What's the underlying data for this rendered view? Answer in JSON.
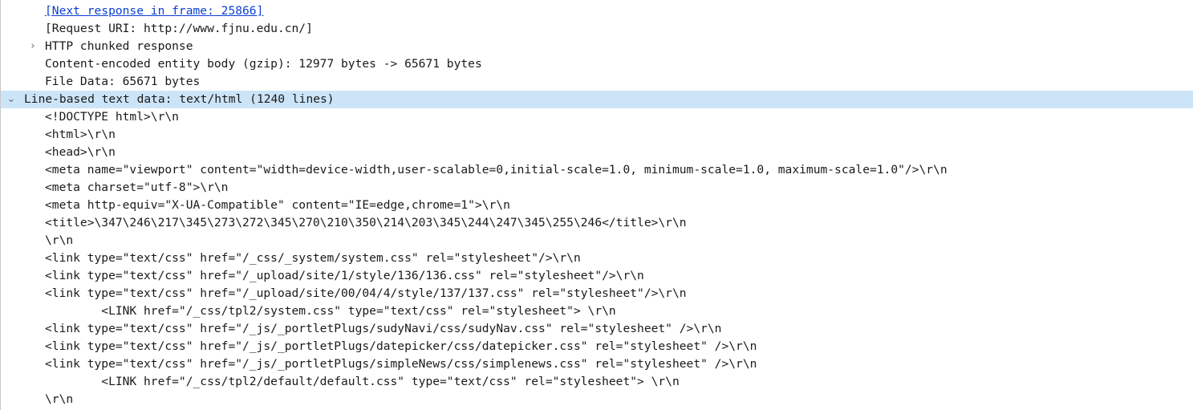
{
  "tree": {
    "next_response": "[Next response in frame: 25866]",
    "request_uri": "[Request URI: http://www.fjnu.edu.cn/]",
    "chunked": "HTTP chunked response",
    "content_encoded": "Content-encoded entity body (gzip): 12977 bytes -> 65671 bytes",
    "file_data": "File Data: 65671 bytes",
    "line_based": "Line-based text data: text/html (1240 lines)",
    "lines": [
      "<!DOCTYPE html>\\r\\n",
      "<html>\\r\\n",
      "<head>\\r\\n",
      "<meta name=\"viewport\" content=\"width=device-width,user-scalable=0,initial-scale=1.0, minimum-scale=1.0, maximum-scale=1.0\"/>\\r\\n",
      "<meta charset=\"utf-8\">\\r\\n",
      "<meta http-equiv=\"X-UA-Compatible\" content=\"IE=edge,chrome=1\">\\r\\n",
      "<title>\\347\\246\\217\\345\\273\\272\\345\\270\\210\\350\\214\\203\\345\\244\\247\\345\\255\\246</title>\\r\\n",
      "\\r\\n",
      "<link type=\"text/css\" href=\"/_css/_system/system.css\" rel=\"stylesheet\"/>\\r\\n",
      "<link type=\"text/css\" href=\"/_upload/site/1/style/136/136.css\" rel=\"stylesheet\"/>\\r\\n",
      "<link type=\"text/css\" href=\"/_upload/site/00/04/4/style/137/137.css\" rel=\"stylesheet\"/>\\r\\n",
      "        <LINK href=\"/_css/tpl2/system.css\" type=\"text/css\" rel=\"stylesheet\"> \\r\\n",
      "<link type=\"text/css\" href=\"/_js/_portletPlugs/sudyNavi/css/sudyNav.css\" rel=\"stylesheet\" />\\r\\n",
      "<link type=\"text/css\" href=\"/_js/_portletPlugs/datepicker/css/datepicker.css\" rel=\"stylesheet\" />\\r\\n",
      "<link type=\"text/css\" href=\"/_js/_portletPlugs/simpleNews/css/simplenews.css\" rel=\"stylesheet\" />\\r\\n",
      "        <LINK href=\"/_css/tpl2/default/default.css\" type=\"text/css\" rel=\"stylesheet\"> \\r\\n",
      "\\r\\n"
    ]
  },
  "colors": {
    "selection": "#cce4f7",
    "link": "#0b3fd0"
  },
  "icons": {
    "collapsed": "chevron-right-icon",
    "expanded": "chevron-down-icon"
  }
}
